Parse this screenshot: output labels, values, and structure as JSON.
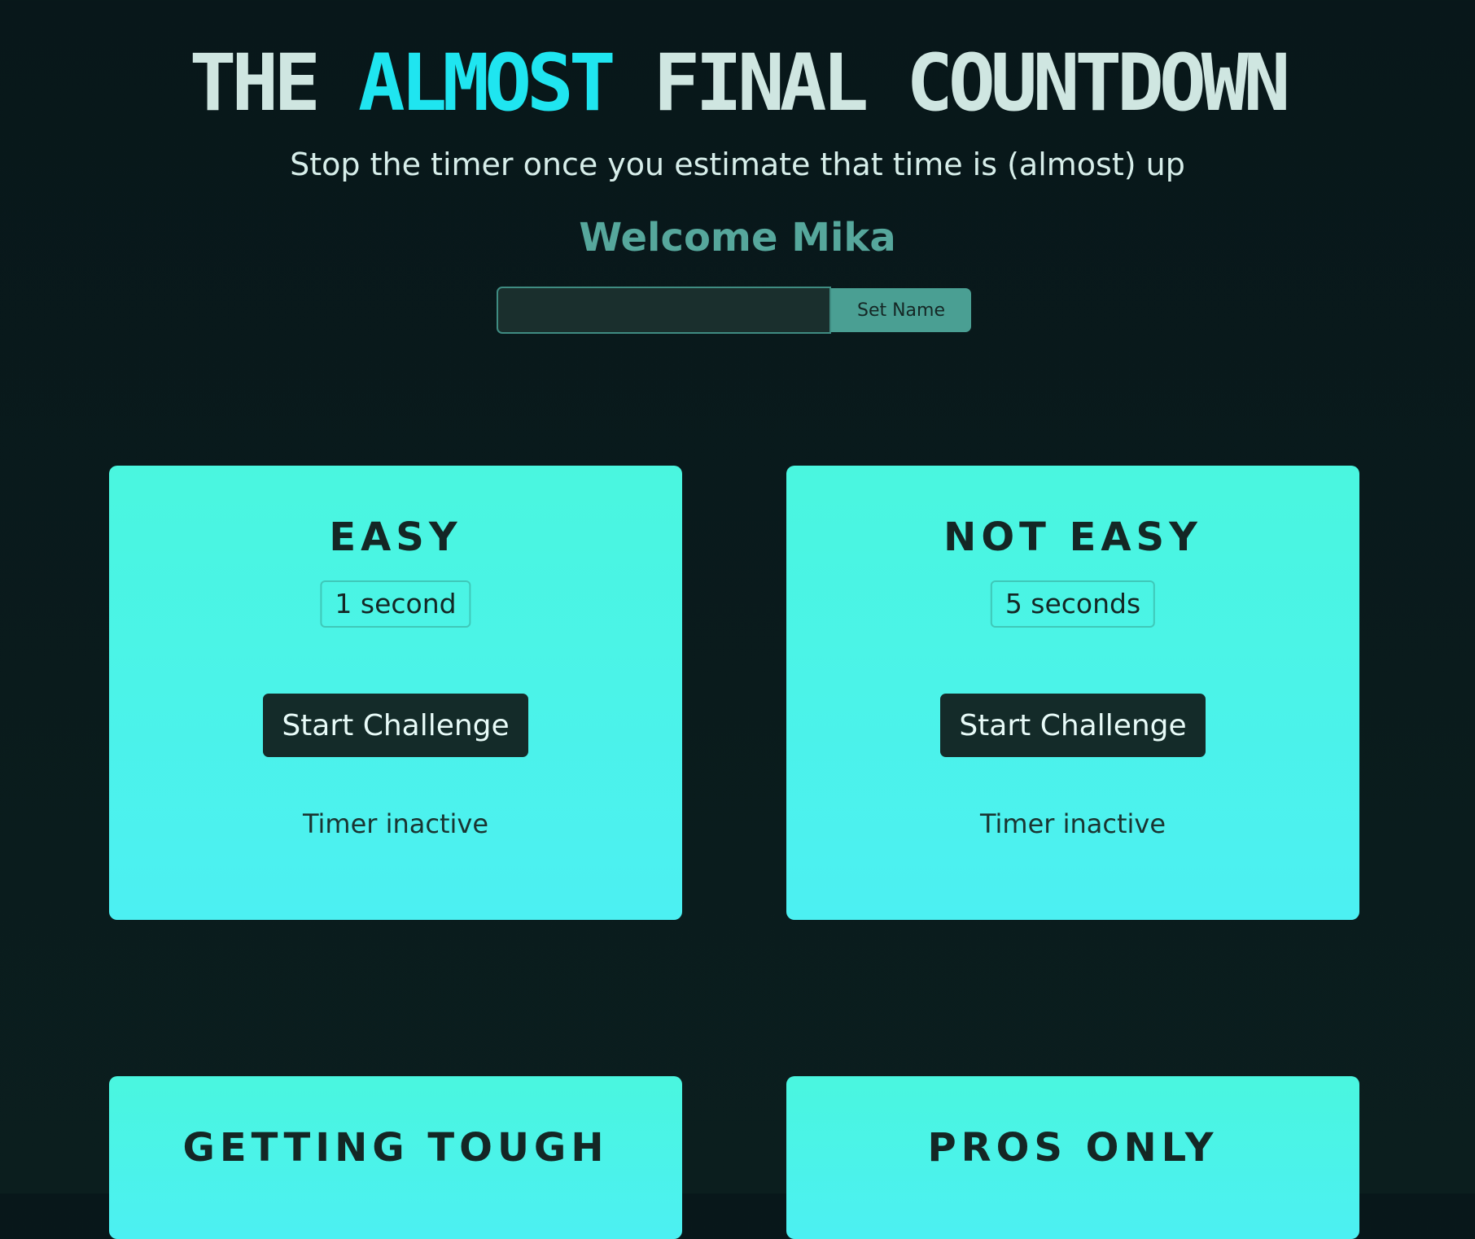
{
  "header": {
    "title_part1": "THE ",
    "title_accent": "ALMOST",
    "title_part2": " FINAL COUNTDOWN",
    "subtitle": "Stop the timer once you estimate that time is (almost) up",
    "welcome": "Welcome Mika"
  },
  "name_form": {
    "input_value": "",
    "input_placeholder": "",
    "button_label": "Set Name"
  },
  "challenges": [
    {
      "title": "EASY",
      "duration": "1 second",
      "button_label": "Start Challenge",
      "status": "Timer inactive"
    },
    {
      "title": "NOT EASY",
      "duration": "5 seconds",
      "button_label": "Start Challenge",
      "status": "Timer inactive"
    },
    {
      "title": "GETTING TOUGH"
    },
    {
      "title": "PROS ONLY"
    }
  ],
  "colors": {
    "background": "#08171a",
    "title": "#cfe6e1",
    "accent": "#1fe5f0",
    "welcome": "#56a79c",
    "card_gradient_top": "#4af6df",
    "card_gradient_bottom": "#4cf0f2",
    "button_dark": "#142b29",
    "set_name_button": "#4a9f93"
  }
}
